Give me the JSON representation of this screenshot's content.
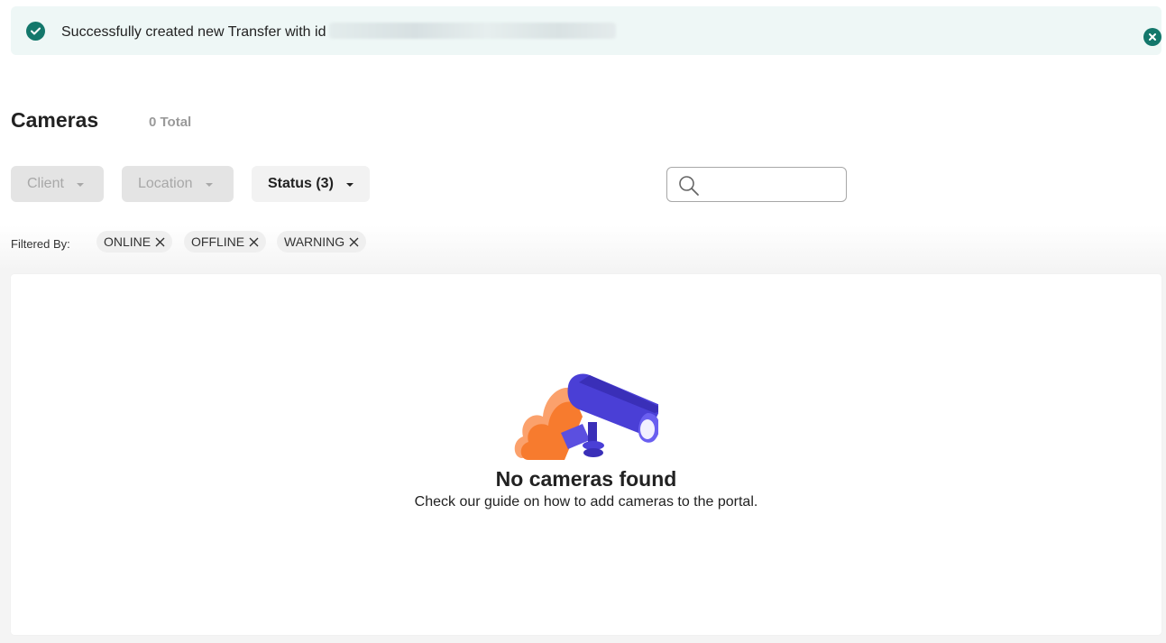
{
  "toast": {
    "message": "Successfully created new Transfer with id",
    "icon": "check-circle-icon",
    "close_icon": "close-circle-icon",
    "accent": "#13776b",
    "background": "#eef7f6"
  },
  "header": {
    "title": "Cameras",
    "total": "0 Total"
  },
  "filters": {
    "client": "Client",
    "location": "Location",
    "status": "Status (3)"
  },
  "search": {
    "placeholder": "",
    "icon": "search-icon"
  },
  "filtered_by": {
    "label": "Filtered By:",
    "chips": [
      "ONLINE",
      "OFFLINE",
      "WARNING"
    ]
  },
  "empty_state": {
    "illustration": "security-camera-cloud-illustration",
    "title": "No cameras found",
    "subtitle": "Check our guide on how to add cameras to the portal."
  },
  "colors": {
    "camera": "#4a3fd6",
    "cloud": "#f77b2e"
  }
}
